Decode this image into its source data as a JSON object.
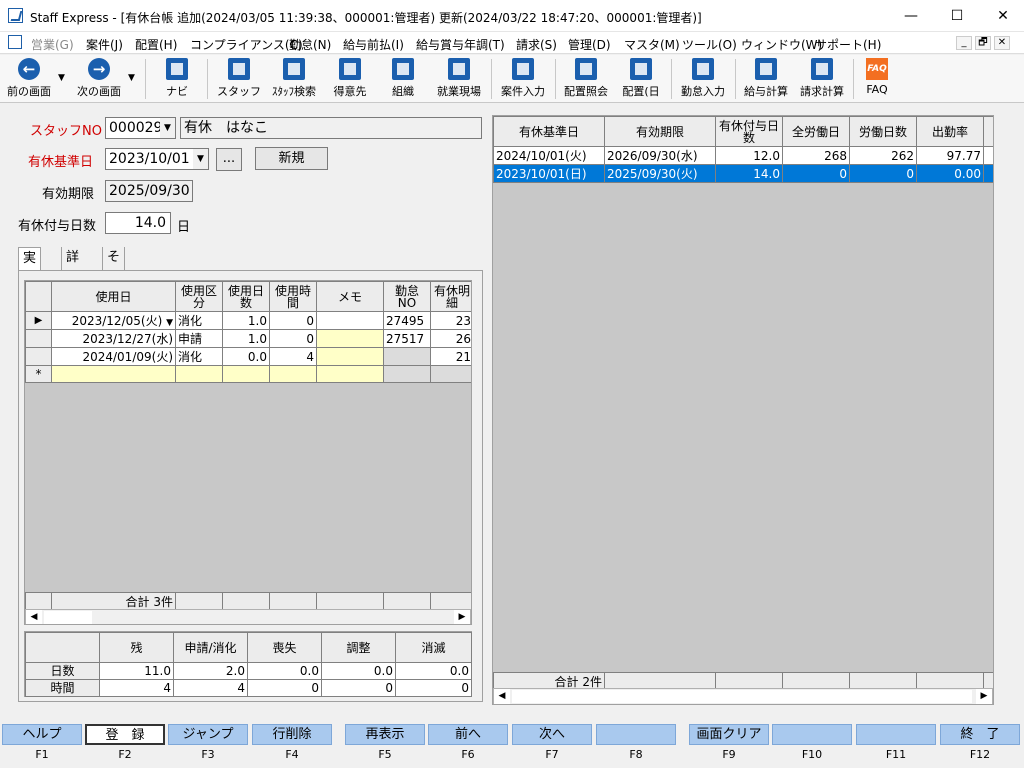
{
  "window": {
    "title": "Staff Express - [有休台帳 追加(2024/03/05 11:39:38、000001:管理者) 更新(2024/03/22 18:47:20、000001:管理者)]",
    "min": "—",
    "max": "☐",
    "close": "✕"
  },
  "menu": [
    "営業(G)",
    "案件(J)",
    "配置(H)",
    "コンプライアンス(C)",
    "勤怠(N)",
    "給与前払(I)",
    "給与賞与年調(T)",
    "請求(S)",
    "管理(D)",
    "マスタ(M)",
    "ツール(O)",
    "ウィンドウ(W)",
    "サポート(H)"
  ],
  "mdi": [
    "_",
    "🗗",
    "✕"
  ],
  "toolbar": [
    {
      "label": "前の画面",
      "icon": "back-arrow-icon"
    },
    {
      "label": "次の画面",
      "icon": "forward-arrow-icon"
    },
    {
      "label": "ナビ",
      "icon": "navi-icon"
    },
    {
      "label": "スタッフ",
      "icon": "staff-icon"
    },
    {
      "label": "ｽﾀｯﾌ検索",
      "icon": "staff-search-icon"
    },
    {
      "label": "得意先",
      "icon": "customer-icon"
    },
    {
      "label": "組織",
      "icon": "organization-icon"
    },
    {
      "label": "就業現場",
      "icon": "worksite-icon"
    },
    {
      "label": "案件入力",
      "icon": "project-input-icon"
    },
    {
      "label": "配置照会",
      "icon": "assignment-inquiry-icon"
    },
    {
      "label": "配置(日",
      "icon": "assignment-daily-icon"
    },
    {
      "label": "勤怠入力",
      "icon": "attendance-input-icon"
    },
    {
      "label": "給与計算",
      "icon": "payroll-icon"
    },
    {
      "label": "請求計算",
      "icon": "billing-icon"
    },
    {
      "label": "FAQ",
      "icon": "faq-icon",
      "icon_text": "FAQ"
    }
  ],
  "form": {
    "staff_no_label": "スタッフNO",
    "staff_no": "000029",
    "staff_name": "有休　はなこ",
    "base_date_label": "有休基準日",
    "base_date": "2023/10/01",
    "ellipsis": "...",
    "new_button": "新規",
    "expiry_label": "有効期限",
    "expiry": "2025/09/30",
    "grant_label": "有休付与日数",
    "grant_days": "14.0",
    "day_unit": "日"
  },
  "tabs": [
    "実績",
    "詳細",
    "その他"
  ],
  "usage_table": {
    "headers": [
      "使用日",
      "使用区分",
      "使用日数",
      "使用時間",
      "メモ",
      "勤怠NO",
      "有休明細"
    ],
    "rows": [
      [
        "2023/12/05(火)",
        "消化",
        "1.0",
        "0",
        "",
        "27495",
        "23"
      ],
      [
        "2023/12/27(水)",
        "申請",
        "1.0",
        "0",
        "",
        "27517",
        "26"
      ],
      [
        "2024/01/09(火)",
        "消化",
        "0.0",
        "4",
        "",
        "",
        "21"
      ]
    ],
    "new_row_marker": "*",
    "current_marker": "▶",
    "total": "合計 3件"
  },
  "summary_table": {
    "headers": [
      "",
      "残",
      "申請/消化",
      "喪失",
      "調整",
      "消滅"
    ],
    "rows": [
      [
        "日数",
        "11.0",
        "2.0",
        "0.0",
        "0.0",
        "0.0"
      ],
      [
        "時間",
        "4",
        "4",
        "0",
        "0",
        "0"
      ]
    ]
  },
  "history_table": {
    "headers": [
      "有休基準日",
      "有効期限",
      "有休付与日数",
      "全労働日",
      "労働日数",
      "出勤率"
    ],
    "rows": [
      [
        "2024/10/01(火)",
        "2026/09/30(水)",
        "12.0",
        "268",
        "262",
        "97.77"
      ],
      [
        "2023/10/01(日)",
        "2025/09/30(火)",
        "14.0",
        "0",
        "0",
        "0.00"
      ]
    ],
    "total": "合計 2件"
  },
  "fkeys": [
    {
      "label": "ヘルプ",
      "key": "F1"
    },
    {
      "label": "登　録",
      "key": "F2"
    },
    {
      "label": "ジャンプ",
      "key": "F3"
    },
    {
      "label": "行削除",
      "key": "F4"
    },
    {
      "label": "再表示",
      "key": "F5"
    },
    {
      "label": "前へ",
      "key": "F6"
    },
    {
      "label": "次へ",
      "key": "F7"
    },
    {
      "label": "",
      "key": "F8"
    },
    {
      "label": "画面クリア",
      "key": "F9"
    },
    {
      "label": "",
      "key": "F10"
    },
    {
      "label": "",
      "key": "F11"
    },
    {
      "label": "終　了",
      "key": "F12"
    }
  ]
}
